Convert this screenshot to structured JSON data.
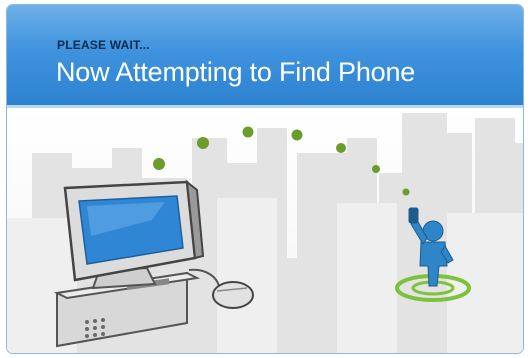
{
  "dialog": {
    "subtitle": "PLEASE WAIT...",
    "title": "Now Attempting to Find Phone"
  },
  "colors": {
    "header_top": "#6fb0e8",
    "header_bottom": "#2d82d0",
    "signal_dot": "#6a9d2c",
    "person": "#2e86c8",
    "target_ring": "#7cc23a",
    "monitor_screen": "#2f86d4"
  },
  "icons": [
    "computer-icon",
    "mouse-icon",
    "signal-dots",
    "person-with-phone-icon",
    "target-ring-icon",
    "city-skyline"
  ]
}
